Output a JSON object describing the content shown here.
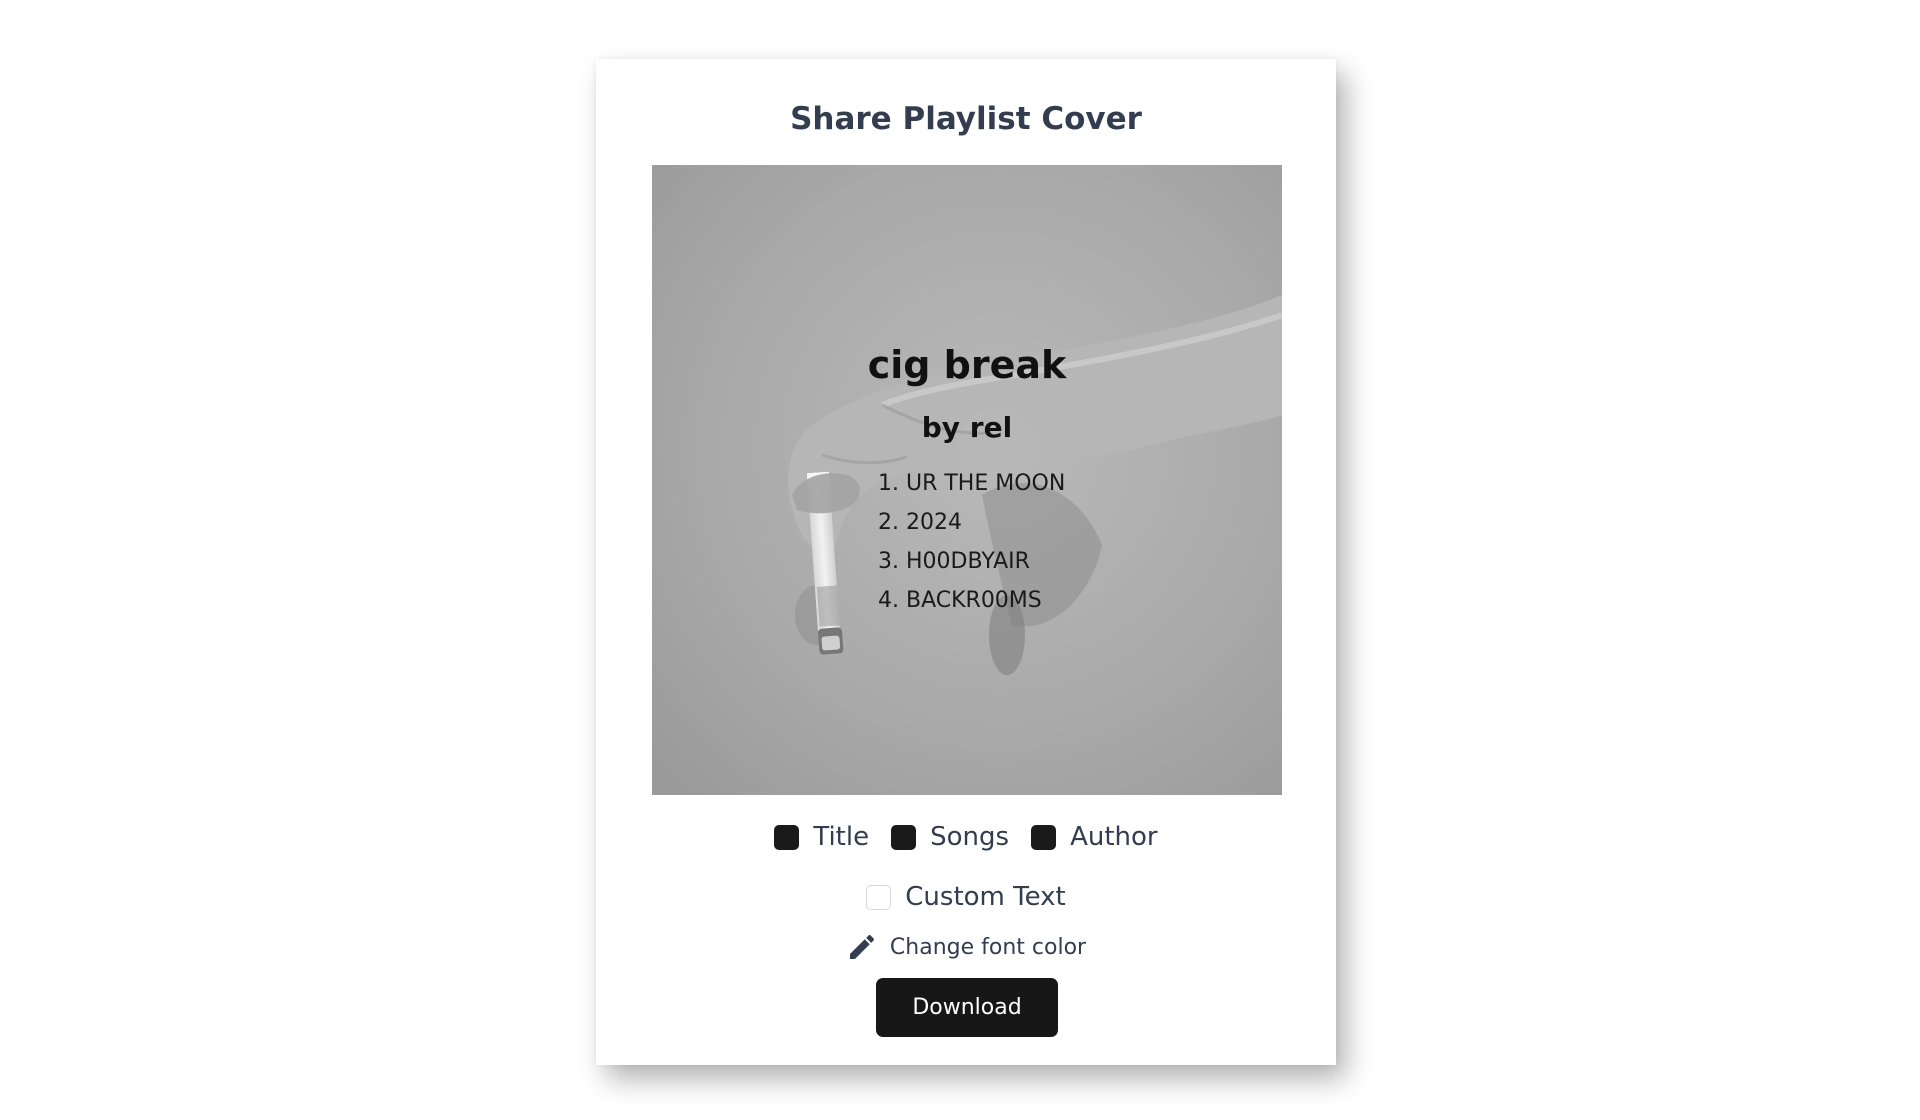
{
  "dialog": {
    "title": "Share Playlist Cover"
  },
  "cover": {
    "title": "cig break",
    "author": "by rel",
    "songs": [
      "1. UR THE MOON",
      "2. 2024",
      "3. H00DBYAIR",
      "4. BACKR00MS"
    ],
    "text_color": "#111111"
  },
  "options": {
    "title_label": "Title",
    "title_checked": true,
    "songs_label": "Songs",
    "songs_checked": true,
    "author_label": "Author",
    "author_checked": true,
    "custom_text_label": "Custom Text",
    "custom_text_checked": false,
    "font_color_label": "Change font color"
  },
  "actions": {
    "download_label": "Download"
  },
  "colors": {
    "text_primary": "#333d4f",
    "button_bg": "#171717",
    "checkbox_checked": "#1a1a1a"
  },
  "icons": {
    "font_color": "pencil-icon"
  }
}
